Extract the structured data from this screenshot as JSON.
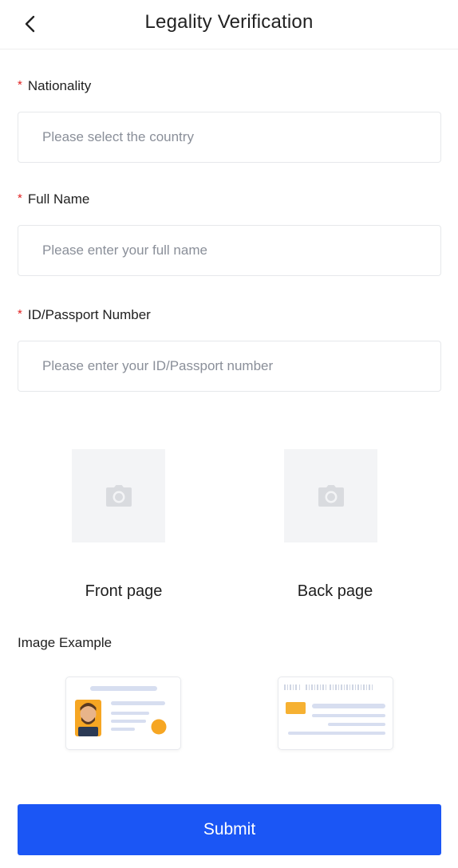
{
  "header": {
    "title": "Legality Verification"
  },
  "form": {
    "required_mark": "*",
    "nationality": {
      "label": "Nationality",
      "placeholder": "Please select the country"
    },
    "full_name": {
      "label": "Full Name",
      "placeholder": "Please enter your full name"
    },
    "id_number": {
      "label": "ID/Passport Number",
      "placeholder": "Please enter your ID/Passport number"
    }
  },
  "upload": {
    "front_label": "Front page",
    "back_label": "Back page"
  },
  "example": {
    "title": "Image Example"
  },
  "actions": {
    "submit_label": "Submit"
  },
  "colors": {
    "primary": "#1b56f5",
    "required": "#e02020",
    "upload_bg": "#f3f4f6",
    "example_accent": "#f6a623",
    "example_line": "#d7def0"
  },
  "icons": {
    "back": "chevron-left-icon",
    "camera": "camera-icon"
  }
}
